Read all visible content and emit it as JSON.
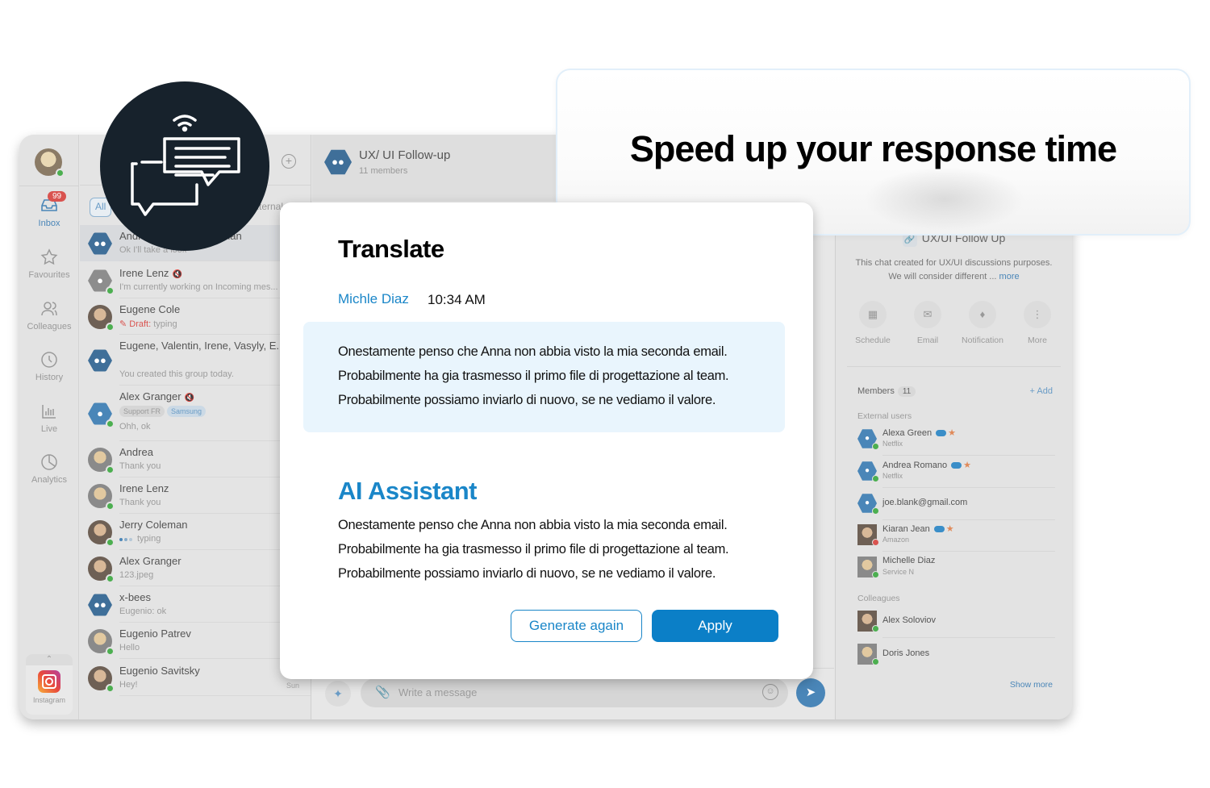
{
  "headline": "Speed up your response time",
  "rail": {
    "inbox_badge": "99",
    "items": [
      {
        "label": "Inbox",
        "icon": "inbox-icon",
        "active": true
      },
      {
        "label": "Favourites",
        "icon": "star-icon"
      },
      {
        "label": "Colleagues",
        "icon": "colleagues-icon"
      },
      {
        "label": "History",
        "icon": "clock-icon"
      },
      {
        "label": "Live",
        "icon": "bar-chart-icon"
      },
      {
        "label": "Analytics",
        "icon": "pie-chart-icon"
      }
    ],
    "bottom_app": {
      "label": "Instagram",
      "icon": "instagram-icon"
    }
  },
  "chatlist": {
    "filters": {
      "all": "All",
      "external": "External"
    },
    "conversations": [
      {
        "name": "Andrea, ..., Jerry Coleman",
        "sub": "Ok I'll take a look",
        "avatar": "group",
        "selected": true
      },
      {
        "name": "Irene Lenz",
        "sub": "I'm currently working on Incoming mes...",
        "avatar": "user-gray",
        "muted": true
      },
      {
        "name": "Eugene Cole",
        "draft_label": "Draft:",
        "sub": "typing",
        "avatar": "photo"
      },
      {
        "name": "Eugene, Valentin, Irene, Vasyly, E...",
        "sub": "You created this group today.",
        "avatar": "group"
      },
      {
        "name": "Alex Granger",
        "tags": [
          "Support FR",
          "Samsung"
        ],
        "sub": "Ohh, ok",
        "avatar": "user-blue",
        "muted": true
      },
      {
        "name": "Andrea",
        "sub": "Thank you",
        "avatar": "photo2"
      },
      {
        "name": "Irene Lenz",
        "sub": "Thank you",
        "avatar": "photo2"
      },
      {
        "name": "Jerry Coleman",
        "sub": "typing",
        "avatar": "photo",
        "typing": true
      },
      {
        "name": "Alex Granger",
        "sub": "123.jpeg",
        "avatar": "photo"
      },
      {
        "name": "x-bees",
        "sub": "Eugenio: ok",
        "avatar": "group"
      },
      {
        "name": "Eugenio Patrev",
        "sub": "Hello",
        "avatar": "photo2"
      },
      {
        "name": "Eugenio Savitsky",
        "sub": "Hey!",
        "avatar": "photo",
        "time": "Sun"
      }
    ]
  },
  "chat": {
    "title": "UX/ UI Follow-up",
    "subtitle": "11 members",
    "composer_placeholder": "Write a message"
  },
  "info": {
    "title": "UX/UI Follow Up",
    "desc_line1": "This chat created for UX/UI discussions purposes.",
    "desc_line2": "We will consider different ...",
    "more": "more",
    "actions": [
      {
        "label": "Schedule",
        "icon": "calendar-icon"
      },
      {
        "label": "Email",
        "icon": "email-icon"
      },
      {
        "label": "Notification",
        "icon": "bell-icon"
      },
      {
        "label": "More",
        "icon": "more-vertical-icon"
      }
    ],
    "members_label": "Members",
    "members_count": "11",
    "add_label": "+ Add",
    "external_label": "External users",
    "external": [
      {
        "name": "Alexa Green",
        "company": "Netflix",
        "status": "online",
        "badges": true,
        "avatar": "user-blue"
      },
      {
        "name": "Andrea Romano",
        "company": "Netflix",
        "status": "online",
        "badges": true,
        "avatar": "user-blue"
      },
      {
        "name": "joe.blank@gmail.com",
        "company": "",
        "status": "online",
        "badges": false,
        "avatar": "user-blue"
      },
      {
        "name": "Kiaran Jean",
        "company": "Amazon",
        "status": "busy",
        "badges": true,
        "avatar": "photo"
      },
      {
        "name": "Michelle Diaz",
        "company": "Service N",
        "status": "online",
        "badges": false,
        "avatar": "photo2"
      }
    ],
    "colleagues_label": "Colleagues",
    "colleagues": [
      {
        "name": "Alex Soloviov",
        "status": "online",
        "avatar": "photo"
      },
      {
        "name": "Doris Jones",
        "status": "online",
        "avatar": "photo2"
      }
    ],
    "show_more": "Show more"
  },
  "modal": {
    "title": "Translate",
    "sender": "Michle Diaz",
    "time": "10:34 AM",
    "original_lines": [
      "Onestamente penso che Anna non abbia visto la mia seconda email.",
      "Probabilmente ha gia trasmesso il primo file di progettazione al team.",
      "Probabilmente possiamo inviarlo di nuovo, se ne vediamo il valore."
    ],
    "ai_title": "AI Assistant",
    "ai_lines": [
      "Onestamente penso che Anna non abbia visto la mia seconda email.",
      "Probabilmente ha gia trasmesso il primo file di progettazione al team.",
      "Probabilmente possiamo inviarlo di nuovo, se ne vediamo il valore."
    ],
    "generate_again": "Generate again",
    "apply": "Apply"
  },
  "colors": {
    "accent": "#0b7fc7",
    "sender_blue": "#1a86c8",
    "translate_bg": "#e9f5fd",
    "logo_bg": "#17222c",
    "online": "#4caf50",
    "busy": "#d9534f"
  }
}
